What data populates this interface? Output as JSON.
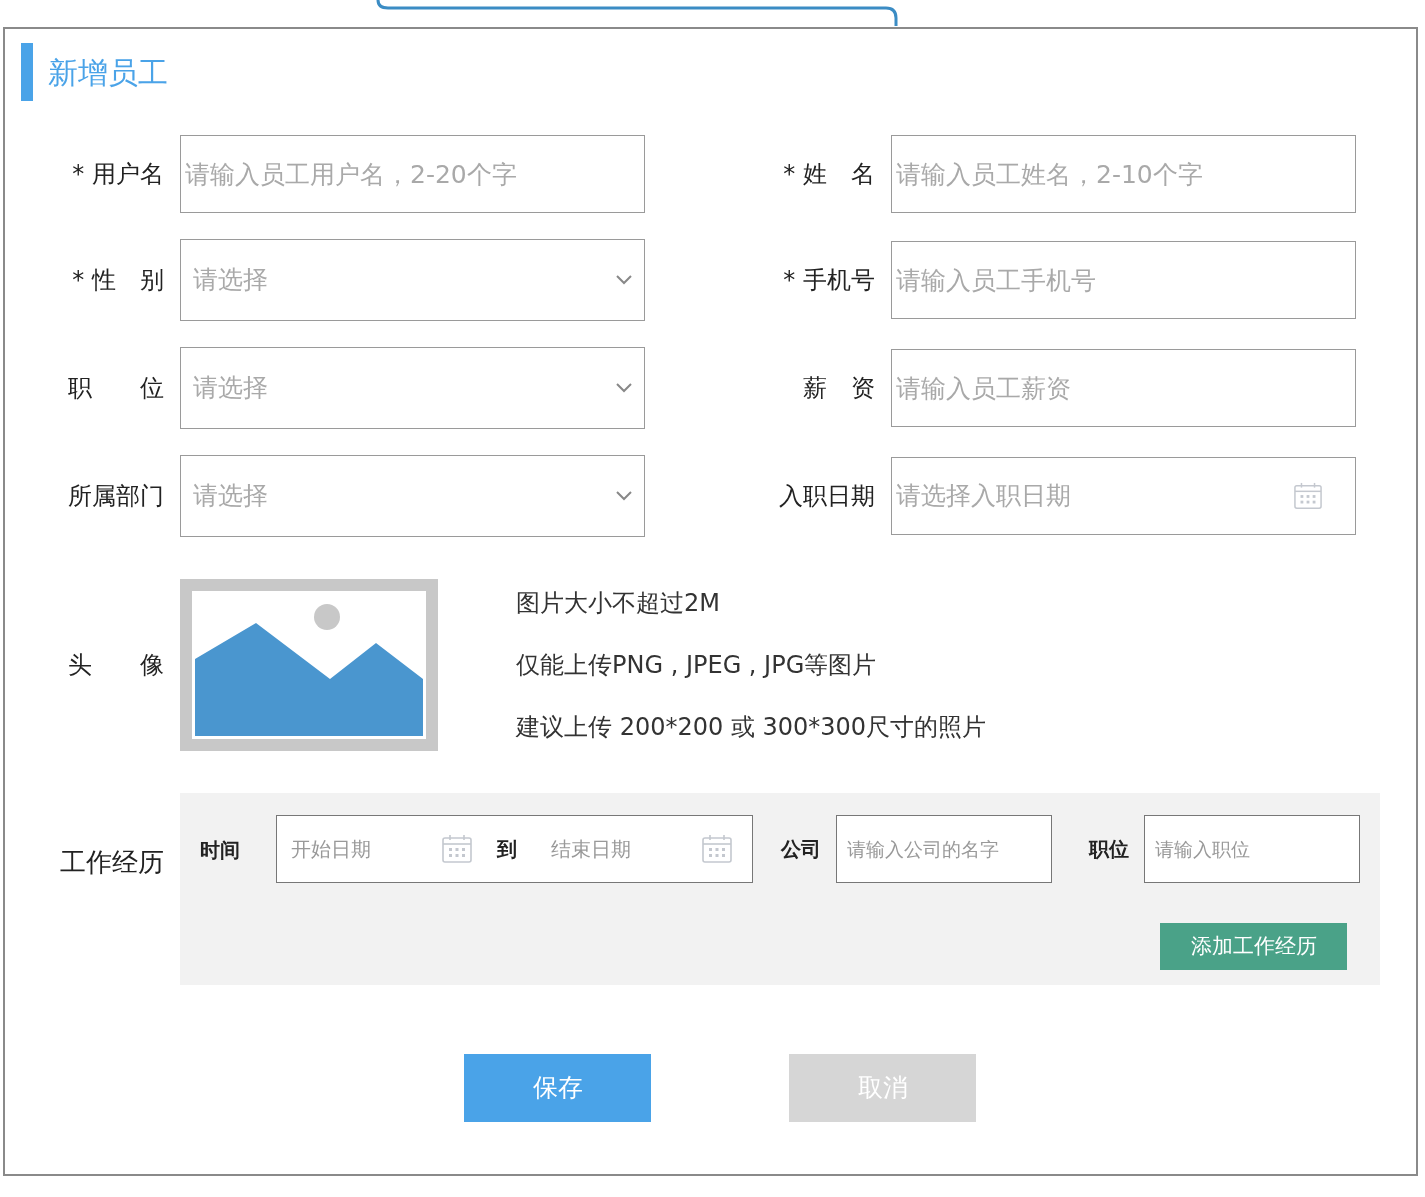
{
  "title": "新增员工",
  "fields": [
    {
      "label": "* 用户名",
      "kind": "text",
      "placeholder": "请输入员工用户名，2-20个字"
    },
    {
      "label": "* 姓　名",
      "kind": "text",
      "placeholder": "请输入员工姓名，2-10个字"
    },
    {
      "label": "* 性　别",
      "kind": "select",
      "placeholder": "请选择"
    },
    {
      "label": "* 手机号",
      "kind": "text",
      "placeholder": "请输入员工手机号"
    },
    {
      "label": "职　　位",
      "kind": "select",
      "placeholder": "请选择"
    },
    {
      "label": "薪　资",
      "kind": "text",
      "placeholder": "请输入员工薪资"
    },
    {
      "label": "所属部门",
      "kind": "select",
      "placeholder": "请选择"
    },
    {
      "label": "入职日期",
      "kind": "date",
      "placeholder": "请选择入职日期"
    }
  ],
  "avatar": {
    "label": "头　　像",
    "notes": [
      "图片大小不超过2M",
      "仅能上传PNG , JPEG , JPG等图片",
      "建议上传 200*200 或 300*300尺寸的照片"
    ]
  },
  "work_history": {
    "label": "工作经历",
    "time_label": "时间",
    "start_placeholder": "开始日期",
    "to": "到",
    "end_placeholder": "结束日期",
    "company_label": "公司",
    "company_placeholder": "请输入公司的名字",
    "position_label": "职位",
    "position_placeholder": "请输入职位",
    "add_button": "添加工作经历"
  },
  "buttons": [
    {
      "label": "保存",
      "kind": "primary"
    },
    {
      "label": "取消",
      "kind": "secondary"
    }
  ]
}
